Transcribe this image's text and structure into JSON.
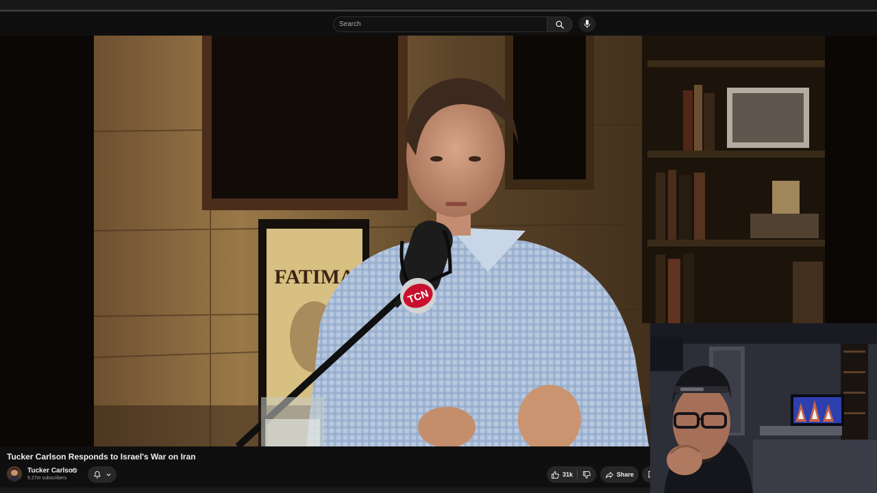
{
  "search": {
    "placeholder": "Search"
  },
  "icons": {
    "search": "search-icon",
    "mic": "microphone-icon",
    "verified": "verified-check-icon",
    "bell": "bell-icon",
    "chevron": "chevron-down-icon",
    "like": "thumbs-up-icon",
    "dislike": "thumbs-down-icon",
    "share": "share-arrow-icon",
    "more": "save-icon"
  },
  "video": {
    "title": "Tucker Carlson Responds to Israel's War on Iran",
    "mic_logo": "TCN",
    "poster_text": "FATIMA"
  },
  "channel": {
    "name": "Tucker Carlson",
    "subscribers": "5.27m subscribers"
  },
  "actions": {
    "like_count": "31k",
    "share_label": "Share"
  },
  "colors": {
    "background": "#0f0f0f",
    "pill": "#272727",
    "text": "#f1f1f1",
    "secondary_text": "#aaaaaa",
    "mic_logo_red": "#c8102e"
  }
}
